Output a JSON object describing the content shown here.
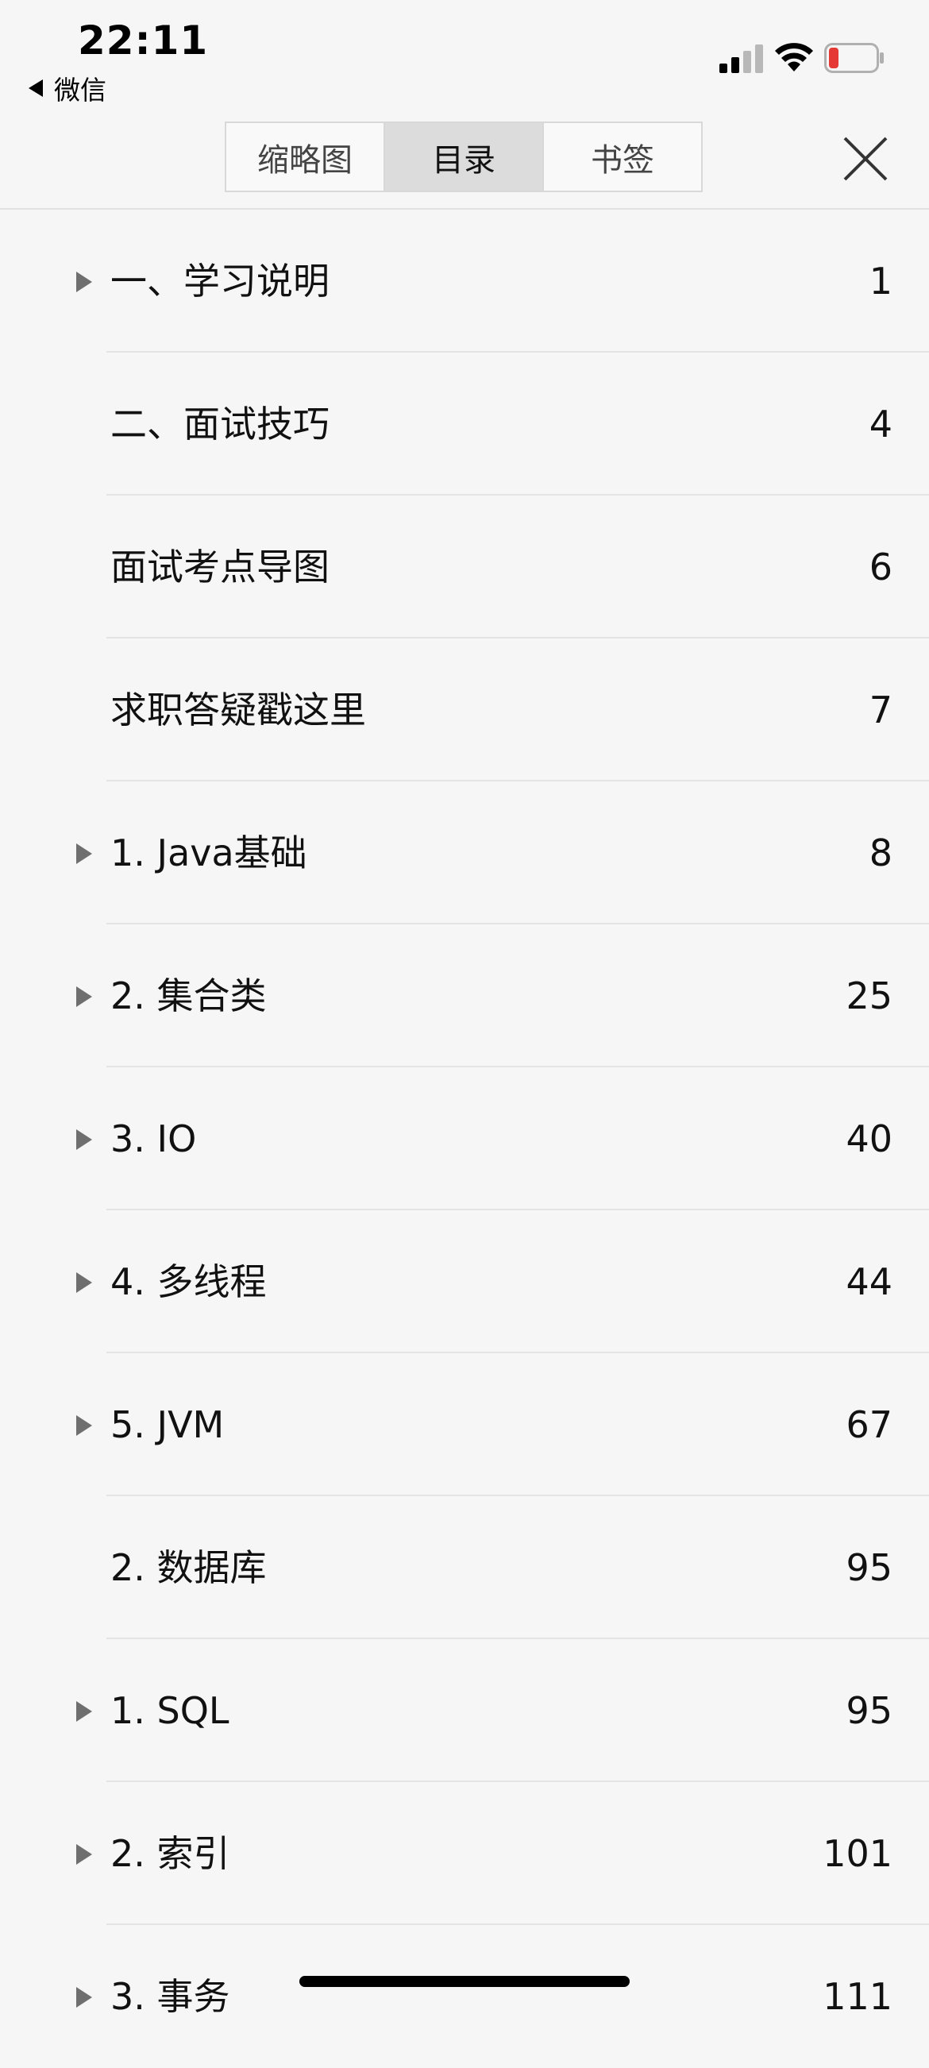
{
  "status_bar": {
    "time": "22:11",
    "back_app": "微信"
  },
  "tabs": [
    {
      "label": "缩略图",
      "active": false
    },
    {
      "label": "目录",
      "active": true
    },
    {
      "label": "书签",
      "active": false
    }
  ],
  "toc": [
    {
      "title": "一、学习说明",
      "page": "1",
      "expandable": true
    },
    {
      "title": "二、面试技巧",
      "page": "4",
      "expandable": false
    },
    {
      "title": "面试考点导图",
      "page": "6",
      "expandable": false
    },
    {
      "title": "求职答疑戳这里",
      "page": "7",
      "expandable": false
    },
    {
      "title": "1. Java基础",
      "page": "8",
      "expandable": true
    },
    {
      "title": "2. 集合类",
      "page": "25",
      "expandable": true
    },
    {
      "title": "3. IO",
      "page": "40",
      "expandable": true
    },
    {
      "title": "4. 多线程",
      "page": "44",
      "expandable": true
    },
    {
      "title": "5. JVM",
      "page": "67",
      "expandable": true
    },
    {
      "title": "2. 数据库",
      "page": "95",
      "expandable": false
    },
    {
      "title": "1. SQL",
      "page": "95",
      "expandable": true
    },
    {
      "title": "2. 索引",
      "page": "101",
      "expandable": true
    },
    {
      "title": "3. 事务",
      "page": "111",
      "expandable": true
    }
  ],
  "colors": {
    "background": "#f6f6f6",
    "active_tab": "#dcdcdc",
    "battery_low": "#e53935"
  }
}
